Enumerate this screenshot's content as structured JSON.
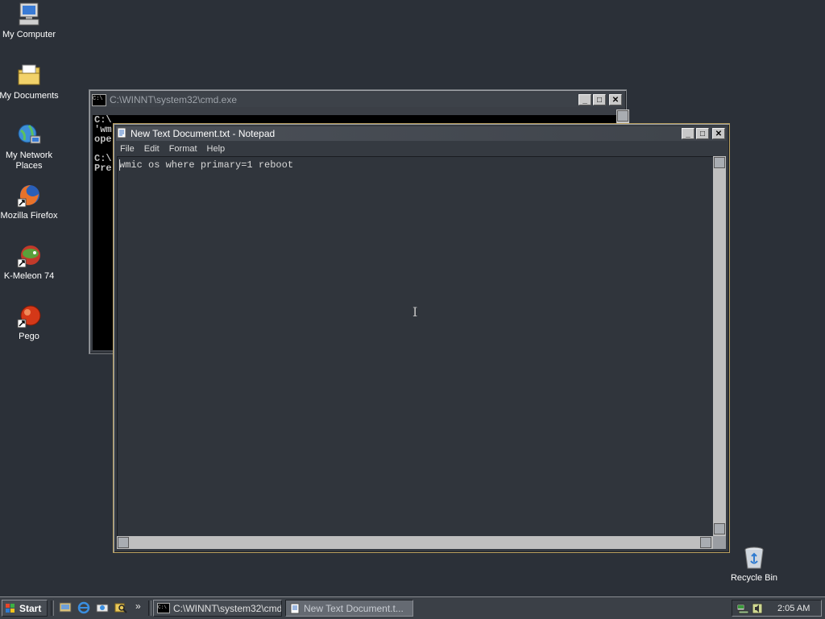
{
  "desktop": {
    "icons": [
      {
        "label": "My Computer",
        "icon": "computer-icon"
      },
      {
        "label": "My Documents",
        "icon": "folder-icon"
      },
      {
        "label": "My Network Places",
        "icon": "network-icon"
      },
      {
        "label": "Mozilla Firefox",
        "icon": "firefox-icon"
      },
      {
        "label": "K-Meleon 74",
        "icon": "kmeleon-icon"
      },
      {
        "label": "Pego",
        "icon": "pego-icon"
      }
    ],
    "recycle_bin": {
      "label": "Recycle Bin",
      "icon": "recycle-bin-icon"
    }
  },
  "cmd_window": {
    "title": "C:\\WINNT\\system32\\cmd.exe",
    "lines": [
      "C:\\",
      "'wm",
      "ope",
      "",
      "C:\\",
      "Pre"
    ]
  },
  "notepad": {
    "title": "New Text Document.txt - Notepad",
    "menu": [
      "File",
      "Edit",
      "Format",
      "Help"
    ],
    "content": "wmic os where primary=1 reboot"
  },
  "window_buttons": {
    "minimize": "_",
    "maximize": "□",
    "close": "✕"
  },
  "taskbar": {
    "start_label": "Start",
    "chevron": "»",
    "tasks": [
      {
        "label": "C:\\WINNT\\system32\\cmd...",
        "icon": "cmd-icon",
        "active": false
      },
      {
        "label": "New Text Document.t...",
        "icon": "notepad-icon",
        "active": true
      }
    ],
    "clock": "2:05 AM"
  },
  "colors": {
    "desktop": "#2b3038",
    "notepad_border": "#b9a060",
    "console": "#000000"
  }
}
